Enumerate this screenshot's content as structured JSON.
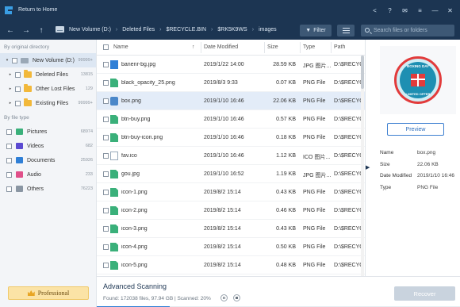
{
  "window": {
    "title": "Return to Home",
    "title_icons": [
      "share-icon",
      "help-icon",
      "notification-icon",
      "menu-icon",
      "minimize-icon",
      "close-icon"
    ]
  },
  "nav": {
    "breadcrumb": [
      "New Volume (D:)",
      "Deleted Files",
      "$RECYCLE.BIN",
      "$RK5K9WS",
      "images"
    ],
    "filter_label": "Filter",
    "search_placeholder": "Search files or folders"
  },
  "sidebar": {
    "original_dir_heading": "By original directory",
    "tree": [
      {
        "label": "New Volume (D:)",
        "count": "99999+",
        "icon": "drive-icon",
        "expanded": true
      },
      {
        "label": "Deleted Files",
        "count": "13815",
        "icon": "folder-icon"
      },
      {
        "label": "Other Lost Files",
        "count": "129",
        "icon": "folder-icon"
      },
      {
        "label": "Existing Files",
        "count": "99999+",
        "icon": "folder-icon"
      }
    ],
    "file_type_heading": "By file type",
    "types": [
      {
        "label": "Pictures",
        "count": "68974",
        "color": "#3ab07a"
      },
      {
        "label": "Videos",
        "count": "682",
        "color": "#5b4ad1"
      },
      {
        "label": "Documents",
        "count": "25926",
        "color": "#2f7fd6"
      },
      {
        "label": "Audio",
        "count": "233",
        "color": "#e0508a"
      },
      {
        "label": "Others",
        "count": "76223",
        "color": "#8a96a3"
      }
    ],
    "professional_label": "Professional"
  },
  "list": {
    "columns": [
      "Name",
      "Date Modified",
      "Size",
      "Type",
      "Path"
    ],
    "rows": [
      {
        "name": "banenr-bg.jpg",
        "date": "2019/1/22 14:00",
        "size": "28.59 KB",
        "type": "JPG 图片...",
        "path": "D:\\$RECYCLE.B",
        "icon": "jpg"
      },
      {
        "name": "black_opacity_25.png",
        "date": "2019/8/3 9:33",
        "size": "0.07 KB",
        "type": "PNG File",
        "path": "D:\\$RECYCLE.B",
        "icon": "png"
      },
      {
        "name": "box.png",
        "date": "2019/1/10 16:46",
        "size": "22.06 KB",
        "type": "PNG File",
        "path": "D:\\$RECYCLE.B",
        "icon": "box",
        "selected": true
      },
      {
        "name": "btn-buy.png",
        "date": "2019/1/10 16:46",
        "size": "0.57 KB",
        "type": "PNG File",
        "path": "D:\\$RECYCLE.B",
        "icon": "png"
      },
      {
        "name": "btn-buy-icon.png",
        "date": "2019/1/10 16:46",
        "size": "0.18 KB",
        "type": "PNG File",
        "path": "D:\\$RECYCLE.B",
        "icon": "png"
      },
      {
        "name": "fav.ico",
        "date": "2019/1/10 16:46",
        "size": "1.12 KB",
        "type": "ICO 图片...",
        "path": "D:\\$RECYCLE.B",
        "icon": "ico"
      },
      {
        "name": "gou.jpg",
        "date": "2019/1/10 16:52",
        "size": "1.19 KB",
        "type": "JPG 图片...",
        "path": "D:\\$RECYCLE.B",
        "icon": "png"
      },
      {
        "name": "icon-1.png",
        "date": "2019/8/2 15:14",
        "size": "0.43 KB",
        "type": "PNG File",
        "path": "D:\\$RECYCLE.B",
        "icon": "png"
      },
      {
        "name": "icon-2.png",
        "date": "2019/8/2 15:14",
        "size": "0.46 KB",
        "type": "PNG File",
        "path": "D:\\$RECYCLE.B",
        "icon": "png"
      },
      {
        "name": "icon-3.png",
        "date": "2019/8/2 15:14",
        "size": "0.43 KB",
        "type": "PNG File",
        "path": "D:\\$RECYCLE.B",
        "icon": "png"
      },
      {
        "name": "icon-4.png",
        "date": "2019/8/2 15:14",
        "size": "0.50 KB",
        "type": "PNG File",
        "path": "D:\\$RECYCLE.B",
        "icon": "png"
      },
      {
        "name": "icon-5.png",
        "date": "2019/8/2 15:14",
        "size": "0.48 KB",
        "type": "PNG File",
        "path": "D:\\$RECYCLE.B",
        "icon": "png"
      }
    ]
  },
  "preview": {
    "image_text_top": "BOXING DAY",
    "image_text_bottom": "LIMITED OFFER",
    "button_label": "Preview",
    "props": [
      {
        "key": "Name",
        "value": "box.png"
      },
      {
        "key": "Size",
        "value": "22.06 KB"
      },
      {
        "key": "Date Modified",
        "value": "2019/1/10 16:46"
      },
      {
        "key": "Type",
        "value": "PNG File"
      }
    ]
  },
  "status": {
    "title": "Advanced Scanning",
    "info": "Found: 172038 files, 97.94 GB  |  Scanned: 20%",
    "progress": 0.2,
    "recover_label": "Recover"
  }
}
